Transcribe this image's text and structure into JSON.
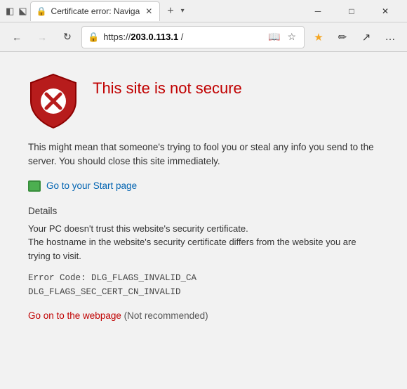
{
  "titlebar": {
    "tab_title": "Certificate error: Naviga",
    "favicon_symbol": "🔒",
    "new_tab_symbol": "+",
    "dropdown_symbol": "▾",
    "minimize_symbol": "─",
    "maximize_symbol": "□",
    "close_symbol": "✕"
  },
  "navbar": {
    "back_symbol": "←",
    "forward_symbol": "→",
    "refresh_symbol": "↻",
    "lock_symbol": "🔒",
    "url_prefix": "https://",
    "url_domain": "203.0.113.1",
    "url_suffix": " /",
    "reading_symbol": "📖",
    "star_symbol": "☆",
    "favorites_symbol": "★",
    "pen_symbol": "✏",
    "share_symbol": "↗",
    "more_symbol": "…"
  },
  "content": {
    "error_title": "This site is not secure",
    "error_description": "This might mean that someone's trying to fool you or steal any info you send to the server. You should close this site immediately.",
    "start_page_link": "Go to your Start page",
    "details_label": "Details",
    "details_text_1": "Your PC doesn't trust this website's security certificate.",
    "details_text_2": "The hostname in the website's security certificate differs from the website you are trying to visit.",
    "error_code_line1": "Error Code:  DLG_FLAGS_INVALID_CA",
    "error_code_line2": "DLG_FLAGS_SEC_CERT_CN_INVALID",
    "go_to_webpage_link": "Go on to the webpage",
    "not_recommended": "(Not recommended)"
  }
}
